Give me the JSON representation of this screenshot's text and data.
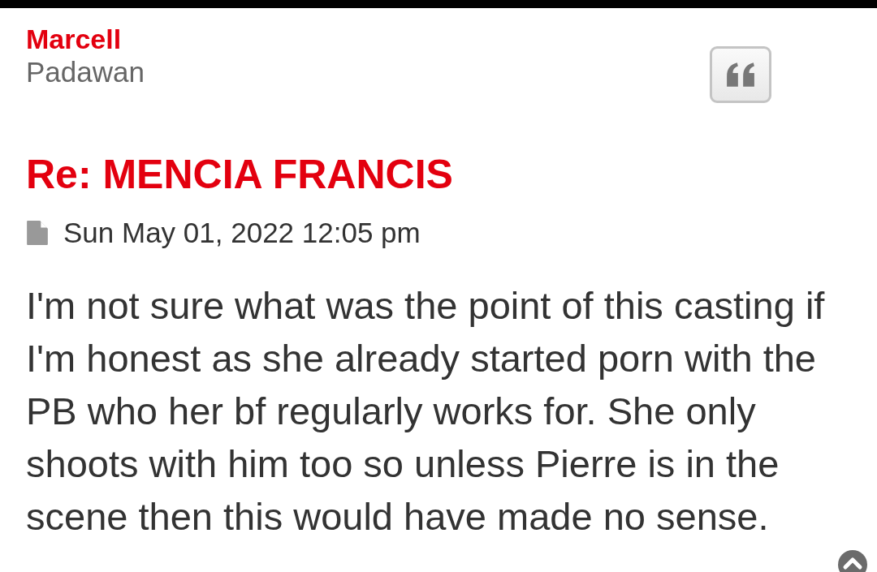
{
  "post": {
    "author": "Marcell",
    "rank": "Padawan",
    "title": "Re: MENCIA FRANCIS",
    "date": "Sun May 01, 2022 12:05 pm",
    "body": "I'm not sure what was the point of this casting if I'm honest as she already started porn with the PB who her bf regularly works for. She only shoots with him too so unless Pierre is in the scene then this would have made no sense."
  }
}
